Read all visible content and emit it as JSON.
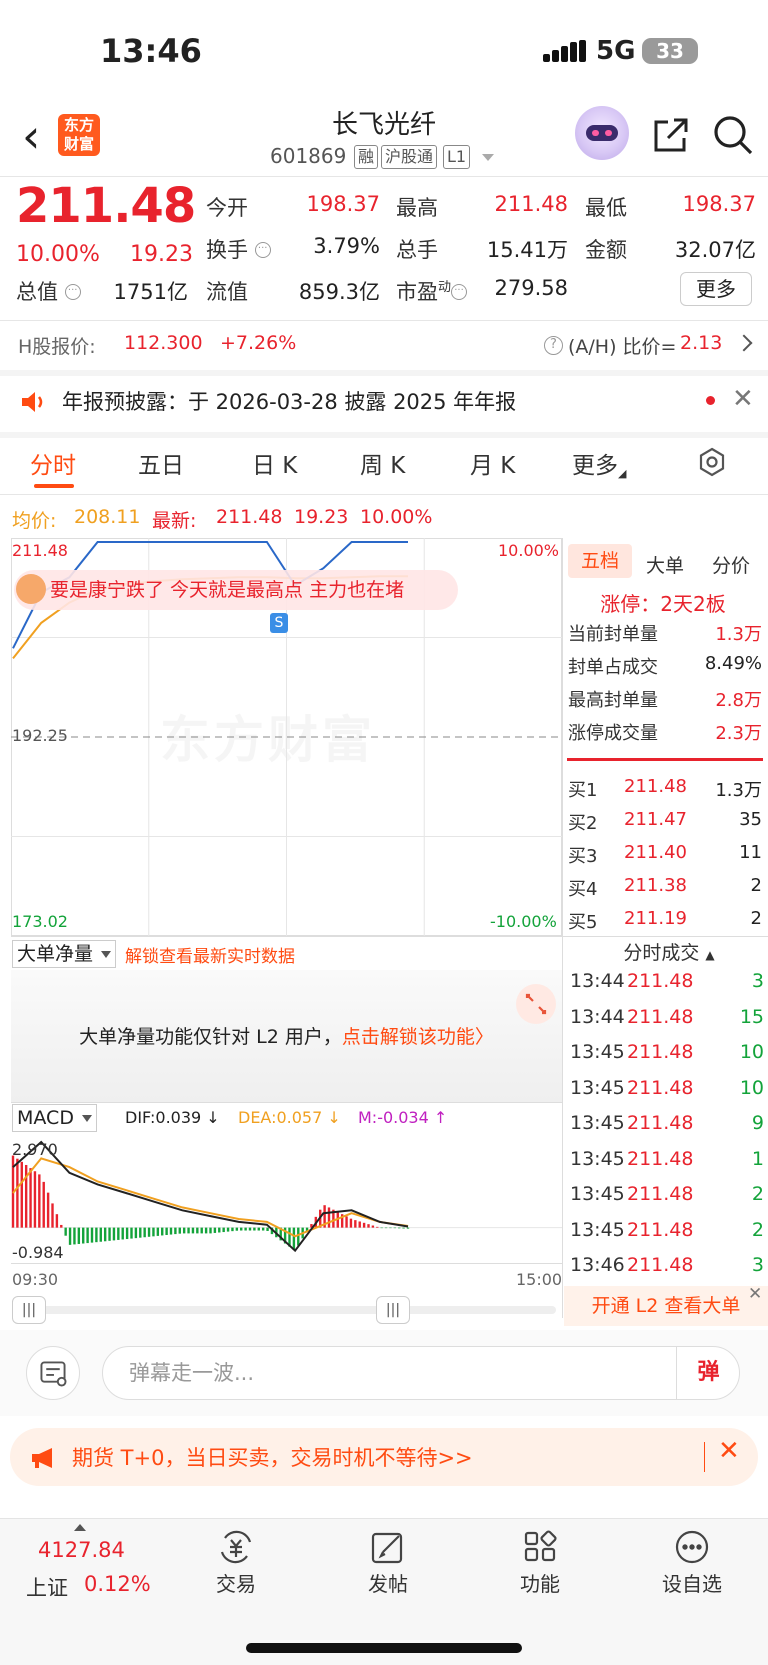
{
  "status": {
    "time": "13:46",
    "network": "5G",
    "battery": "33"
  },
  "header": {
    "logo": [
      "东方",
      "财富"
    ],
    "name": "长飞光纤",
    "code": "601869",
    "tags": [
      "融",
      "沪股通",
      "L1"
    ]
  },
  "quote": {
    "price": "211.48",
    "pct": "10.00%",
    "change": "19.23",
    "fields": {
      "open_label": "今开",
      "open": "198.37",
      "high_label": "最高",
      "high": "211.48",
      "low_label": "最低",
      "low": "198.37",
      "turnover_label": "换手",
      "turnover": "3.79%",
      "volume_label": "总手",
      "volume": "15.41万",
      "amount_label": "金额",
      "amount": "32.07亿",
      "mktcap_label": "总值",
      "mktcap": "1751亿",
      "float_label": "流值",
      "float": "859.3亿",
      "pe_label": "市盈",
      "pe_sup": "动",
      "pe": "279.58"
    },
    "more_label": "更多"
  },
  "hshare": {
    "label": "H股报价:",
    "price": "112.300",
    "pct": "+7.26%",
    "ratio_label": "(A/H) 比价=",
    "ratio": "2.13"
  },
  "notice": {
    "text": "年报预披露：于 2026-03-28 披露 2025 年年报"
  },
  "tabs": [
    "分时",
    "五日",
    "日 K",
    "周 K",
    "月 K",
    "更多"
  ],
  "avg_row": {
    "avg_label": "均价:",
    "avg": "208.11",
    "last_label": "最新:",
    "last": "211.48",
    "chg": "19.23",
    "pct": "10.00%"
  },
  "chart": {
    "top_price": "211.48",
    "mid_price": "192.25",
    "bottom_price": "173.02",
    "top_pct": "10.00%",
    "bottom_pct": "-10.00%",
    "watermark": "东方财富",
    "danmu": "要是康宁跌了 今天就是最高点 主力也在堵",
    "marker": "S",
    "time_start": "09:30",
    "time_end": "15:00"
  },
  "chart_data": {
    "type": "line",
    "title": "",
    "xlabel": "",
    "ylabel": "",
    "x": [
      "09:30",
      "09:45",
      "10:00",
      "10:15",
      "10:30",
      "10:45",
      "11:00",
      "11:15",
      "11:30",
      "13:00",
      "13:10",
      "13:20",
      "13:30",
      "13:40",
      "13:46"
    ],
    "ylim": [
      173.02,
      211.48
    ],
    "prev_close": 192.25,
    "series": [
      {
        "color": "#2a68c8",
        "values": [
          201.0,
          206.5,
          208.0,
          211.48,
          211.48,
          211.48,
          211.48,
          211.48,
          211.48,
          211.48,
          207.2,
          208.9,
          211.48,
          211.48,
          211.48
        ]
      },
      {
        "color": "#f0a020",
        "values": [
          200.0,
          203.5,
          205.5,
          206.8,
          207.3,
          207.6,
          207.8,
          207.9,
          208.0,
          208.0,
          207.9,
          207.9,
          208.0,
          208.1,
          208.11
        ]
      }
    ],
    "macd": {
      "dif": "0.039",
      "dea": "0.057",
      "m": "-0.034",
      "max_label": "2.970",
      "min_label": "-0.984",
      "ylim": [
        -0.984,
        2.97
      ],
      "dif_values": [
        2.1,
        2.97,
        1.9,
        1.5,
        1.2,
        0.9,
        0.6,
        0.4,
        0.2,
        0.1,
        -0.8,
        0.5,
        0.6,
        0.2,
        0.039
      ],
      "dea_values": [
        1.2,
        2.4,
        2.1,
        1.6,
        1.3,
        1.0,
        0.7,
        0.5,
        0.3,
        0.2,
        -0.3,
        0.1,
        0.5,
        0.2,
        0.057
      ],
      "bar_values": [
        2.5,
        1.8,
        -0.6,
        -0.5,
        -0.4,
        -0.3,
        -0.2,
        -0.2,
        -0.1,
        -0.1,
        -0.8,
        0.8,
        0.3,
        0.0,
        -0.034
      ]
    }
  },
  "right_panel": {
    "tabs": [
      "五档",
      "大单",
      "分价"
    ],
    "limit_up": "涨停：2天2板",
    "stats": [
      {
        "k": "当前封单量",
        "v": "1.3万",
        "color": "#e8232d"
      },
      {
        "k": "封单占成交",
        "v": "8.49%",
        "color": "#222"
      },
      {
        "k": "最高封单量",
        "v": "2.8万",
        "color": "#e8232d"
      },
      {
        "k": "涨停成交量",
        "v": "2.3万",
        "color": "#e8232d"
      }
    ],
    "bids": [
      {
        "k": "买1",
        "p": "211.48",
        "q": "1.3万"
      },
      {
        "k": "买2",
        "p": "211.47",
        "q": "35"
      },
      {
        "k": "买3",
        "p": "211.40",
        "q": "11"
      },
      {
        "k": "买4",
        "p": "211.38",
        "q": "2"
      },
      {
        "k": "买5",
        "p": "211.19",
        "q": "2"
      }
    ],
    "ticks_header": "分时成交",
    "ticks": [
      {
        "t": "13:44",
        "p": "211.48",
        "q": "3"
      },
      {
        "t": "13:44",
        "p": "211.48",
        "q": "15"
      },
      {
        "t": "13:45",
        "p": "211.48",
        "q": "10"
      },
      {
        "t": "13:45",
        "p": "211.48",
        "q": "10"
      },
      {
        "t": "13:45",
        "p": "211.48",
        "q": "9"
      },
      {
        "t": "13:45",
        "p": "211.48",
        "q": "1"
      },
      {
        "t": "13:45",
        "p": "211.48",
        "q": "2"
      },
      {
        "t": "13:45",
        "p": "211.48",
        "q": "2"
      },
      {
        "t": "13:46",
        "p": "211.48",
        "q": "3"
      }
    ],
    "l2_banner": "开通 L2 查看大单"
  },
  "big_order": {
    "select": "大单净量",
    "unlock": "解锁查看最新实时数据",
    "msg": "大单净量功能仅针对 L2 用户，",
    "msg_link": "点击解锁该功能〉"
  },
  "macd_row": {
    "select": "MACD",
    "dif": "DIF:0.039 ↓",
    "dea": "DEA:0.057 ↓",
    "m": "M:-0.034 ↑"
  },
  "danmu_bar": {
    "placeholder": "弹幕走一波...",
    "send": "弹"
  },
  "futures": {
    "text": "期货 T+0，当日买卖，交易时机不等待>>"
  },
  "bottom_nav": {
    "index_value": "4127.84",
    "index_name": "上证",
    "index_pct": "0.12%",
    "items": [
      "交易",
      "发帖",
      "功能",
      "设自选"
    ]
  }
}
